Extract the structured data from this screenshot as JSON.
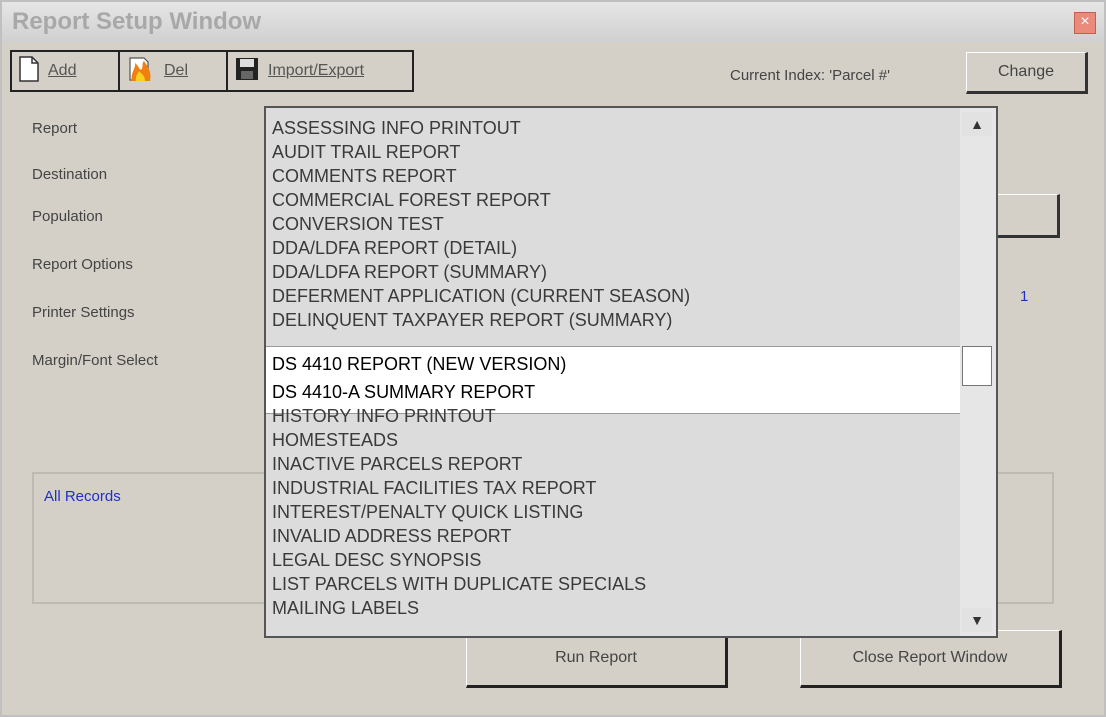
{
  "window": {
    "title": "Report Setup Window",
    "close_glyph": "×"
  },
  "toolbar": {
    "add_label": "Add",
    "del_label": "Del",
    "import_export_label": "Import/Export",
    "current_index": "Current Index: 'Parcel #'",
    "change_label": "Change"
  },
  "form": {
    "report_label": "Report",
    "destination_label": "Destination",
    "population_label": "Population",
    "report_options_label": "Report Options",
    "printer_settings_label": "Printer Settings",
    "margin_font_label": "Margin/Font Select",
    "copies_value": "1"
  },
  "population": {
    "value": "All Records"
  },
  "buttons": {
    "run_report": "Run Report",
    "close_window": "Close Report Window"
  },
  "report_list": {
    "items": [
      "ASSESSING INFO PRINTOUT",
      "AUDIT TRAIL REPORT",
      "COMMENTS REPORT",
      "COMMERCIAL FOREST REPORT",
      "CONVERSION TEST",
      "DDA/LDFA REPORT (DETAIL)",
      "DDA/LDFA REPORT (SUMMARY)",
      "DEFERMENT APPLICATION (CURRENT SEASON)",
      "DELINQUENT TAXPAYER REPORT (SUMMARY)",
      "DS 4410 REPORT (NEW VERSION)",
      "DS 4410-A SUMMARY REPORT",
      "HISTORY INFO PRINTOUT",
      "HOMESTEADS",
      "INACTIVE PARCELS REPORT",
      "INDUSTRIAL FACILITIES TAX REPORT",
      "INTEREST/PENALTY QUICK LISTING",
      "INVALID ADDRESS REPORT",
      "LEGAL DESC SYNOPSIS",
      "LIST PARCELS WITH DUPLICATE SPECIALS",
      "MAILING LABELS"
    ],
    "highlighted": [
      "DS 4410 REPORT (NEW VERSION)",
      "DS 4410-A SUMMARY REPORT"
    ]
  },
  "icons": {
    "add": "new-document-icon",
    "del": "delete-icon",
    "import_export": "floppy-disk-icon",
    "scroll_up": "scroll-up-arrow-icon",
    "scroll_down": "scroll-down-arrow-icon"
  }
}
